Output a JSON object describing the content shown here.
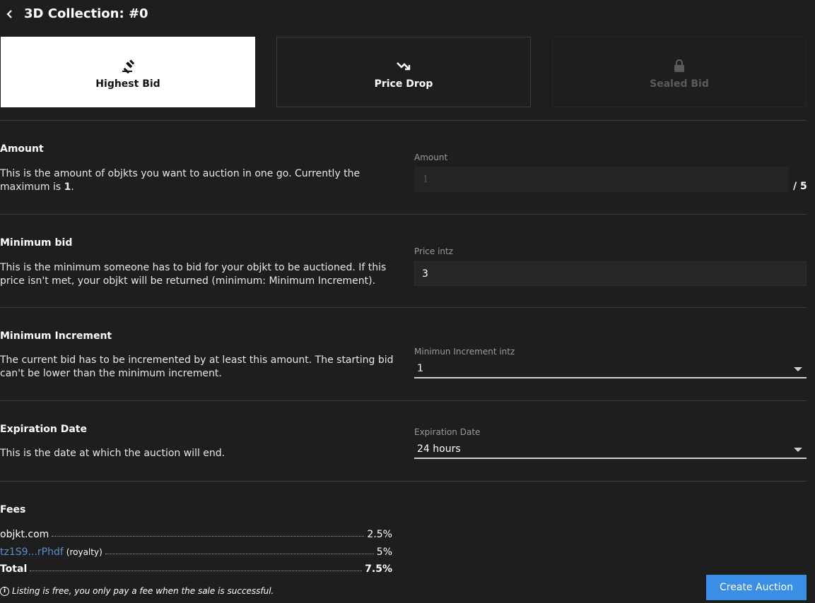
{
  "header": {
    "title": "3D Collection: #0"
  },
  "tabs": [
    {
      "label": "Highest Bid",
      "state": "active",
      "icon": "gavel-icon"
    },
    {
      "label": "Price Drop",
      "state": "normal",
      "icon": "trending-down-icon"
    },
    {
      "label": "Sealed Bid",
      "state": "disabled",
      "icon": "lock-icon"
    }
  ],
  "amount": {
    "title": "Amount",
    "desc_pre": "This is the amount of objkts you want to auction in one go. Currently the maximum is ",
    "desc_bold": "1",
    "desc_post": ".",
    "field_label": "Amount",
    "value": "1",
    "max": "/ 5"
  },
  "min_bid": {
    "title": "Minimum bid",
    "desc": "This is the minimum someone has to bid for your objkt to be auctioned. If this price isn't met, your objkt will be returned (minimum: Minimum Increment).",
    "field_label": "Price intz",
    "value": "3"
  },
  "min_increment": {
    "title": "Minimum Increment",
    "desc": "The current bid has to be incremented by at least this amount. The starting bid can't be lower than the minimum increment.",
    "field_label": "Minimun Increment intz",
    "value": "1"
  },
  "expiration": {
    "title": "Expiration Date",
    "desc": "This is the date at which the auction will end.",
    "field_label": "Expiration Date",
    "value": "24 hours"
  },
  "fees": {
    "title": "Fees",
    "rows": [
      {
        "name": "objkt.com",
        "role": "",
        "value": "2.5%"
      },
      {
        "name": "tz1S9...rPhdf",
        "role": "(royalty)",
        "value": "5%"
      },
      {
        "name": "Total",
        "role": "",
        "value": "7.5%"
      }
    ],
    "notice": "Listing is free, you only pay a fee when the sale is successful."
  },
  "actions": {
    "create_label": "Create Auction"
  },
  "colors": {
    "background": "#1e1e1e",
    "accent": "#3a8ee6",
    "link": "#5a8ec9"
  }
}
